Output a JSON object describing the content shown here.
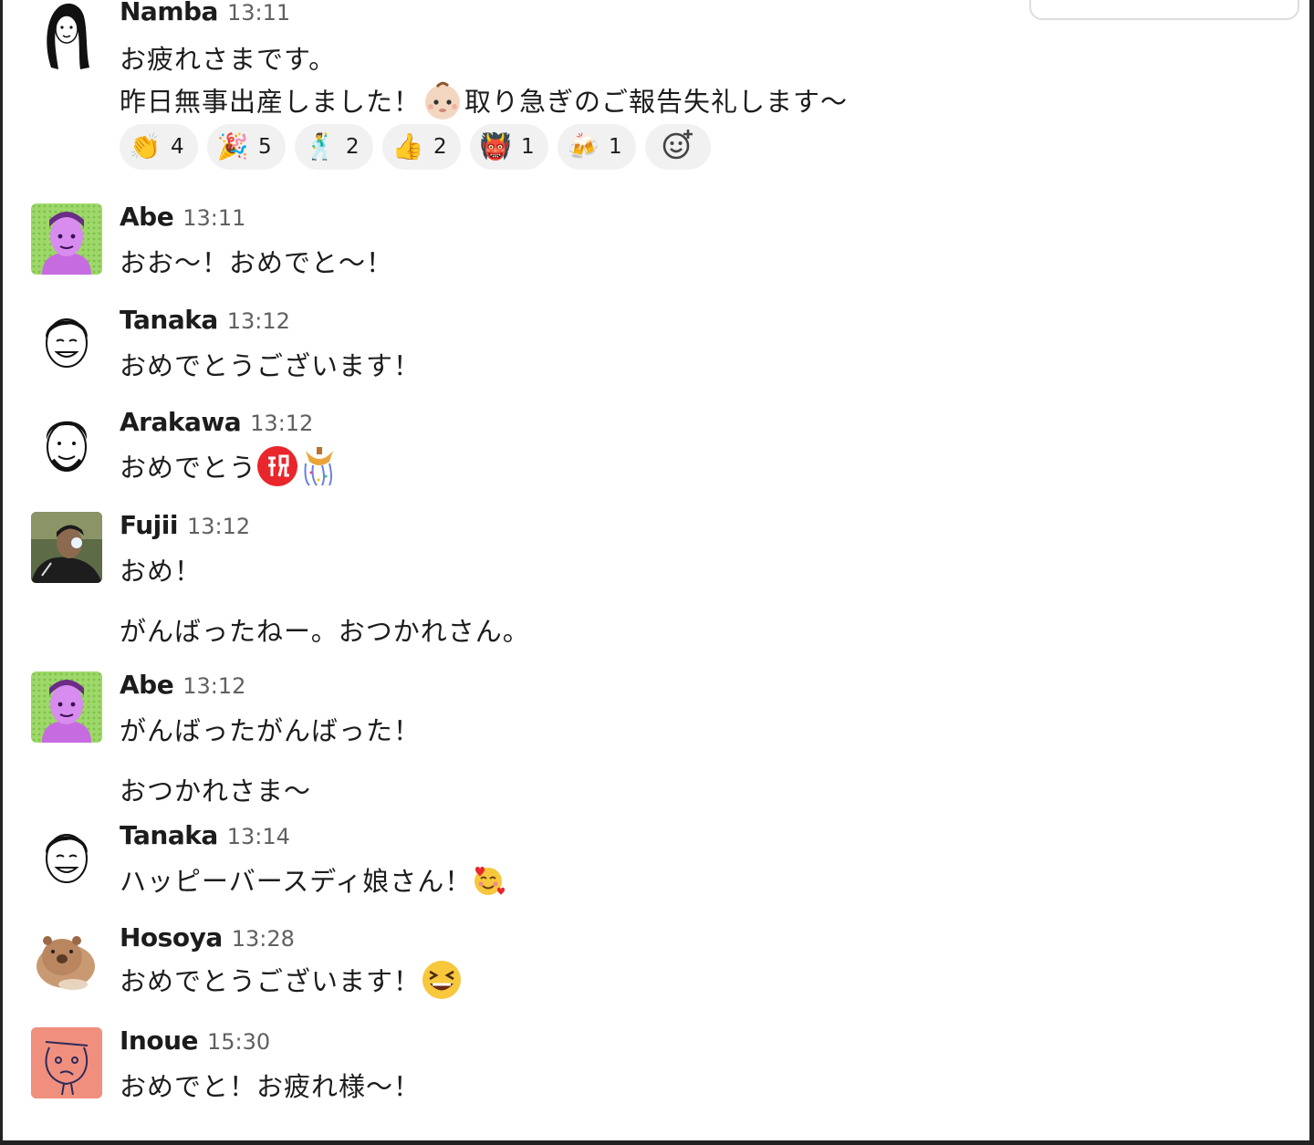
{
  "messages": [
    {
      "name": "Namba",
      "time": "13:11",
      "lines": [
        "お疲れさまです。",
        "昨日無事出産しました！",
        "取り急ぎのご報告失礼します〜"
      ]
    },
    {
      "name": "Abe",
      "time": "13:11",
      "lines": [
        "おお〜！おめでと〜！"
      ]
    },
    {
      "name": "Tanaka",
      "time": "13:12",
      "lines": [
        "おめでとうございます！"
      ]
    },
    {
      "name": "Arakawa",
      "time": "13:12",
      "lines": [
        "おめでとう"
      ]
    },
    {
      "name": "Fujii",
      "time": "13:12",
      "lines": [
        "おめ！",
        "がんばったねー。おつかれさん。"
      ]
    },
    {
      "name": "Abe",
      "time": "13:12",
      "lines": [
        "がんばったがんばった！",
        "おつかれさま〜"
      ]
    },
    {
      "name": "Tanaka",
      "time": "13:14",
      "lines": [
        "ハッピーバースディ娘さん！"
      ]
    },
    {
      "name": "Hosoya",
      "time": "13:28",
      "lines": [
        "おめでとうございます！"
      ]
    },
    {
      "name": "Inoue",
      "time": "15:30",
      "lines": [
        "おめでと！お疲れ様〜！"
      ]
    }
  ],
  "reactions": [
    {
      "icon": "clapping-hands",
      "glyph": "👏",
      "count": "4"
    },
    {
      "icon": "party-popper",
      "glyph": "🎉",
      "count": "5"
    },
    {
      "icon": "dancing-man",
      "glyph": "🕺",
      "count": "2"
    },
    {
      "icon": "thumbs-up",
      "glyph": "👍",
      "count": "2"
    },
    {
      "icon": "oni-mask",
      "glyph": "👹",
      "count": "1"
    },
    {
      "icon": "beer-mugs",
      "glyph": "🍻",
      "count": "1"
    }
  ],
  "add_reaction_icon": "add-reaction-icon",
  "colors": {
    "name": "#1d1c1d",
    "time": "#616061",
    "reaction_bg": "#f1f1f1",
    "iwai_red": "#e8262b"
  }
}
